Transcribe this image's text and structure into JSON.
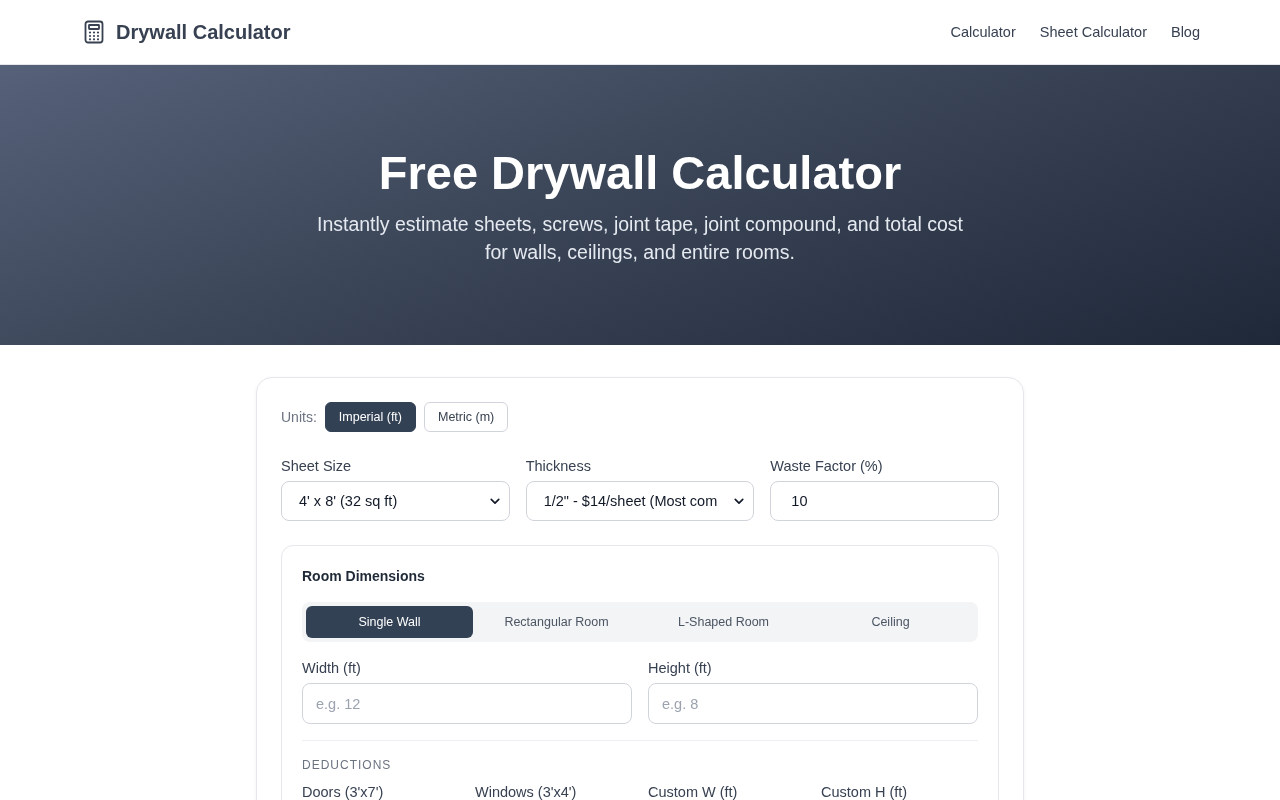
{
  "header": {
    "logo_text": "Drywall Calculator",
    "nav": [
      {
        "label": "Calculator"
      },
      {
        "label": "Sheet Calculator"
      },
      {
        "label": "Blog"
      }
    ]
  },
  "hero": {
    "title": "Free Drywall Calculator",
    "subtitle": "Instantly estimate sheets, screws, joint tape, joint compound, and total cost for walls, ceilings, and entire rooms."
  },
  "calculator": {
    "units": {
      "label": "Units:",
      "options": [
        {
          "label": "Imperial (ft)",
          "selected": true
        },
        {
          "label": "Metric (m)",
          "selected": false
        }
      ]
    },
    "fields": [
      {
        "kind": "select",
        "label": "Sheet Size",
        "value": "4' x 8' (32 sq ft)"
      },
      {
        "kind": "select",
        "label": "Thickness",
        "value": "1/2\" - $14/sheet (Most com"
      },
      {
        "kind": "input",
        "label": "Waste Factor (%)",
        "value": "10"
      }
    ],
    "room_dimensions": {
      "title": "Room Dimensions",
      "tabs": [
        {
          "label": "Single Wall",
          "selected": true
        },
        {
          "label": "Rectangular Room",
          "selected": false
        },
        {
          "label": "L-Shaped Room",
          "selected": false
        },
        {
          "label": "Ceiling",
          "selected": false
        }
      ],
      "fields": [
        {
          "label": "Width (ft)",
          "placeholder": "e.g. 12"
        },
        {
          "label": "Height (ft)",
          "placeholder": "e.g. 8"
        }
      ],
      "deductions": {
        "title": "DEDUCTIONS",
        "labels": [
          "Doors (3'x7')",
          "Windows (3'x4')",
          "Custom W (ft)",
          "Custom H (ft)"
        ]
      }
    }
  }
}
